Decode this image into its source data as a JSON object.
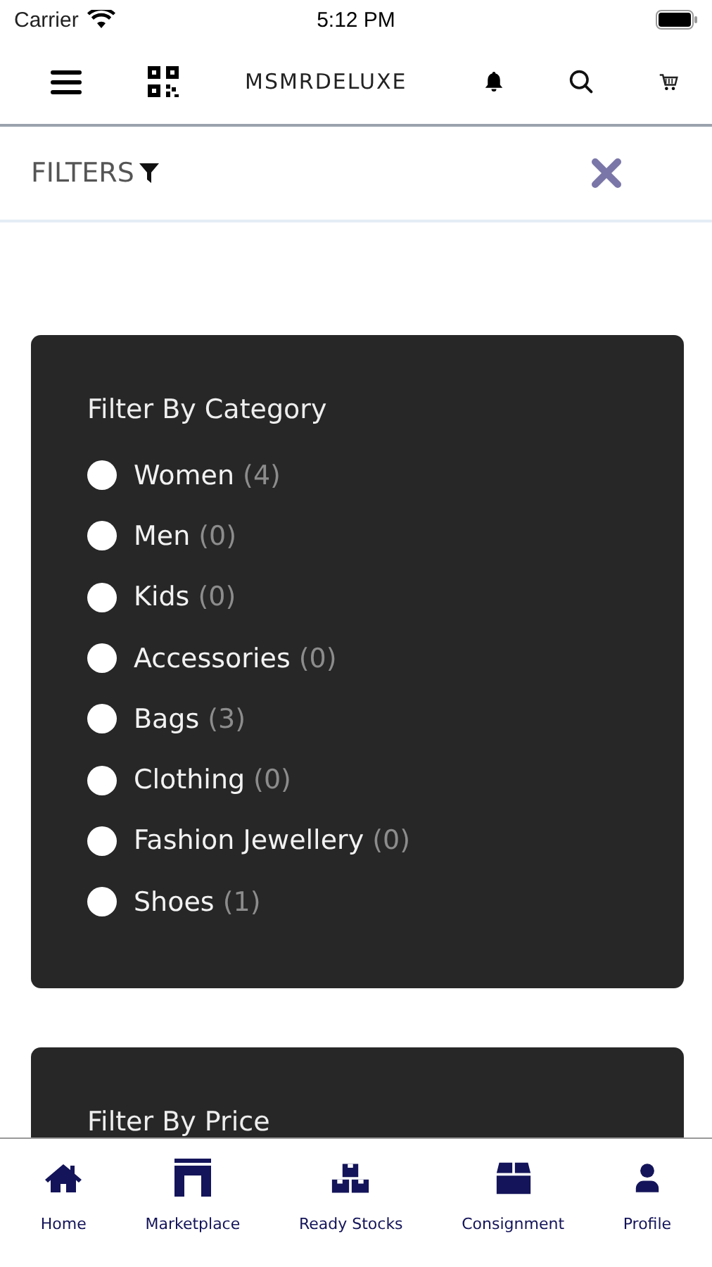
{
  "status_bar": {
    "carrier": "Carrier",
    "time": "5:12 PM"
  },
  "header": {
    "title": "MSMRDELUXE"
  },
  "filters_bar": {
    "label": "FILTERS"
  },
  "category_filter": {
    "title": "Filter By Category",
    "options": [
      {
        "label": "Women",
        "count": "(4)",
        "selected": false
      },
      {
        "label": "Men",
        "count": "(0)",
        "selected": false
      },
      {
        "label": "Kids",
        "count": "(0)",
        "selected": false
      },
      {
        "label": "Accessories",
        "count": "(0)",
        "selected": false
      },
      {
        "label": "Bags",
        "count": "(3)",
        "selected": false
      },
      {
        "label": "Clothing",
        "count": "(0)",
        "selected": false
      },
      {
        "label": "Fashion Jewellery",
        "count": "(0)",
        "selected": false
      },
      {
        "label": "Shoes",
        "count": "(1)",
        "selected": false
      }
    ]
  },
  "price_filter": {
    "title": "Filter By Price"
  },
  "tab_bar": [
    {
      "kind": "home",
      "label": "Home"
    },
    {
      "kind": "marketplace",
      "label": "Marketplace"
    },
    {
      "kind": "stocks",
      "label": "Ready Stocks"
    },
    {
      "kind": "consignment",
      "label": "Consignment"
    },
    {
      "kind": "profile",
      "label": "Profile"
    }
  ]
}
